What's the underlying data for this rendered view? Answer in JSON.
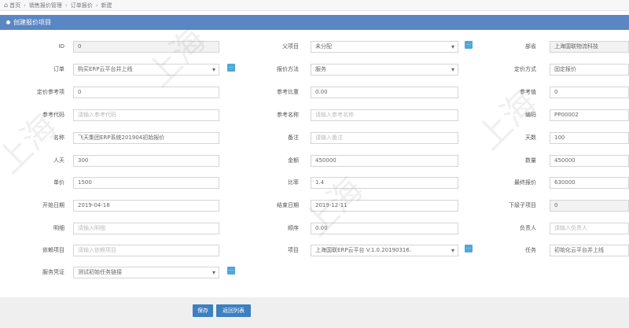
{
  "breadcrumb": [
    "首页",
    "销售报价管理",
    "订单报价",
    "新建"
  ],
  "panel_title": "创建报价项目",
  "fields": {
    "id": {
      "label": "ID",
      "value": "0"
    },
    "parent": {
      "label": "父项目",
      "value": "未分配"
    },
    "group": {
      "label": "部省",
      "value": "上海国联物流科技"
    },
    "order": {
      "label": "订单",
      "value": "购买ERP云平台并上线"
    },
    "quote_method": {
      "label": "报价方法",
      "value": "服务"
    },
    "price_mode": {
      "label": "定价方式",
      "value": "固定报价"
    },
    "price_ref_item": {
      "label": "定价参考项",
      "value": "0"
    },
    "ref_ratio": {
      "label": "参考比重",
      "value": "0.00"
    },
    "ref_value": {
      "label": "参考值",
      "value": "0"
    },
    "ref_code": {
      "label": "参考代码",
      "placeholder": "请输入参考代码"
    },
    "ref_name": {
      "label": "参考名称",
      "placeholder": "请输入参考名称"
    },
    "code": {
      "label": "编码",
      "value": "PP00002"
    },
    "name": {
      "label": "名称",
      "value": "飞天集团ERP系统201904初始报价"
    },
    "remark": {
      "label": "备注",
      "placeholder": "请输入备注"
    },
    "days": {
      "label": "天数",
      "value": "100"
    },
    "man_days": {
      "label": "人天",
      "value": "300"
    },
    "amount": {
      "label": "金额",
      "value": "450000"
    },
    "quantity": {
      "label": "数量",
      "value": "450000"
    },
    "unit_price": {
      "label": "单价",
      "value": "1500"
    },
    "ratio": {
      "label": "比率",
      "value": "1.4"
    },
    "final_quote": {
      "label": "最终报价",
      "value": "630000"
    },
    "start_date": {
      "label": "开始日期",
      "value": "2019-04-18"
    },
    "end_date": {
      "label": "结束日期",
      "value": "2019-12-11"
    },
    "child_count": {
      "label": "下级子项目",
      "value": "0"
    },
    "detail": {
      "label": "明细",
      "placeholder": "请输入明细"
    },
    "order_no": {
      "label": "顺序",
      "value": "0.00"
    },
    "owner": {
      "label": "负责人",
      "placeholder": "请输入负责人"
    },
    "depend": {
      "label": "依赖项目",
      "placeholder": "请输入依赖项目"
    },
    "project": {
      "label": "项目",
      "value": "上海国联ERP云平台 V.1.0.20190316."
    },
    "task": {
      "label": "任务",
      "value": "初始化云平台并上线"
    },
    "service_cert": {
      "label": "服务凭证",
      "value": "测试初始任务链接"
    }
  },
  "buttons": {
    "save": "保存",
    "back": "返回列表"
  },
  "mini_button_glyph": "…",
  "icons": {
    "home": "home-icon",
    "panel": "info-icon"
  }
}
